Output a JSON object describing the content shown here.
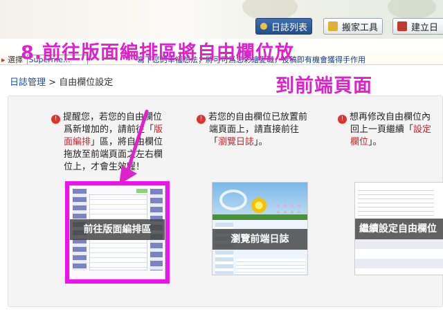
{
  "toolbar": {
    "diary_list": "日誌列表",
    "moving_tool": "搬家工具",
    "create": "建立日"
  },
  "marquee": {
    "select_label": "選擇",
    "select_value": "Superme...",
    "scroll_text": "寫下您的幸福想法；將可可爲您彩繪愛職，投稿即有機會獲得手作用"
  },
  "breadcrumb": {
    "root": "日誌管理",
    "separator": " > ",
    "current": "自由欄位設定"
  },
  "overlay": {
    "line1": "8.前往版面編排區將自由欄位放",
    "line2": "到前端頁面"
  },
  "notes": [
    {
      "lines": [
        "提醒您，若您的自由欄位",
        "爲新增加的，請前往「版",
        "面編排」區，將自由欄位",
        "拖放至前端頁面之左右欄",
        "位上，才會生效喔！"
      ],
      "link_parts": [
        "版",
        "面編排"
      ]
    },
    {
      "lines": [
        "若您的自由欄位已放置前",
        "端頁面上，請直接前往",
        "「瀏覽日誌」。"
      ],
      "link_parts": [
        "瀏覽日誌"
      ]
    },
    {
      "lines": [
        "想再修改自由欄位內",
        "回上一頁繼續「設定",
        "欄位」。"
      ],
      "link_parts": [
        "設定",
        "欄位"
      ]
    }
  ],
  "cards": {
    "layout": "前往版面編排區",
    "browse": "瀏覽前端日誌",
    "continue": "繼續設定自由欄位"
  },
  "colors": {
    "highlight": "#ee11ee",
    "link": "#c1272d",
    "accent": "#1f4ea8"
  }
}
